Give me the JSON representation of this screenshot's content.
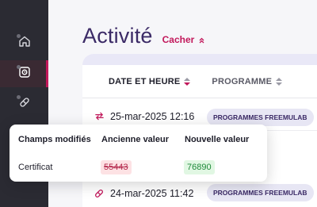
{
  "sidebar": {
    "items": [
      {
        "icon": "home-icon"
      },
      {
        "icon": "activity-icon",
        "active": true
      },
      {
        "icon": "pill-icon"
      }
    ]
  },
  "header": {
    "title": "Activité",
    "hide_link": "Cacher"
  },
  "table": {
    "columns": [
      {
        "label": "DATE ET HEURE",
        "sort": "desc"
      },
      {
        "label": "PROGRAMME"
      }
    ],
    "rows": [
      {
        "icon": "swap-icon",
        "date": "25-mar-2025 12:16",
        "program": "PROGRAMMES FREEMULAB"
      },
      {
        "icon": "pill-icon",
        "date": "24-mar-2025 11:42",
        "program": "PROGRAMMES FREEMULAB"
      }
    ]
  },
  "popover": {
    "headers": [
      "Champs modifiés",
      "Ancienne valeur",
      "Nouvelle valeur"
    ],
    "field": "Certificat",
    "old_value": "55443",
    "new_value": "76890"
  },
  "colors": {
    "accent": "#c2185b",
    "title": "#3b2a66",
    "sidebar": "#2b2b33"
  }
}
